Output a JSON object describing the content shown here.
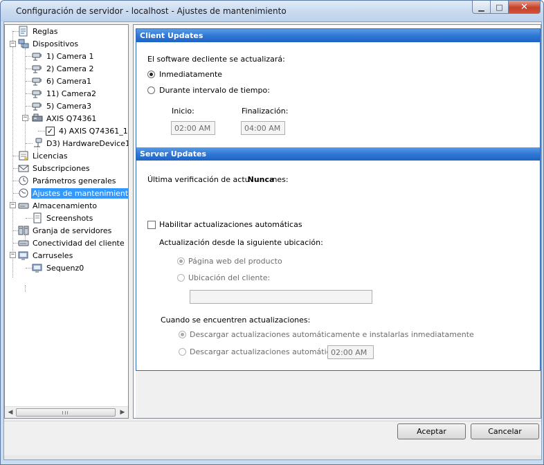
{
  "window": {
    "title": "Configuración de servidor - localhost - Ajustes de mantenimiento",
    "minimize_glyph": "▁",
    "maximize_glyph": "□",
    "close_glyph": "✕"
  },
  "tree": {
    "items": [
      {
        "label": "Reglas",
        "icon": "rules-icon"
      },
      {
        "label": "Dispositivos",
        "icon": "devices-icon"
      },
      {
        "label": "1) Camera 1",
        "icon": "camera-icon"
      },
      {
        "label": "2) Camera 2",
        "icon": "camera-icon"
      },
      {
        "label": "6) Camera1",
        "icon": "camera-icon"
      },
      {
        "label": "11) Camera2",
        "icon": "camera-icon"
      },
      {
        "label": "5) Camera3",
        "icon": "camera-icon"
      },
      {
        "label": "AXIS Q74361",
        "icon": "encoder-icon"
      },
      {
        "label": "4) AXIS Q74361_1",
        "icon": "checkbox-icon"
      },
      {
        "label": "D3) HardwareDevice1",
        "icon": "hardware-device-icon"
      },
      {
        "label": "Licencias",
        "icon": "licenses-icon"
      },
      {
        "label": "Subscripciones",
        "icon": "subscriptions-icon"
      },
      {
        "label": "Parámetros generales",
        "icon": "general-settings-icon"
      },
      {
        "label": "Ajustes de mantenimiento",
        "icon": "maintenance-icon"
      },
      {
        "label": "Almacenamiento",
        "icon": "storage-icon"
      },
      {
        "label": "Screenshots",
        "icon": "screenshots-icon"
      },
      {
        "label": "Granja de servidores",
        "icon": "server-farm-icon"
      },
      {
        "label": "Conectividad del cliente",
        "icon": "client-connectivity-icon"
      },
      {
        "label": "Carruseles",
        "icon": "carousels-icon"
      },
      {
        "label": "Sequenz0",
        "icon": "sequence-icon"
      }
    ],
    "selected_index": 13,
    "checked_item": "4) AXIS Q74361_1",
    "scroll_left_glyph": "◀",
    "scroll_right_glyph": "▶"
  },
  "client_updates": {
    "header": "Client Updates",
    "prompt": "El software decliente se actualizará:",
    "option_immediately": "Inmediatamente",
    "option_interval": "Durante intervalo de tiempo:",
    "selected_option": "Inmediatamente",
    "start_label": "Inicio:",
    "start_value": "02:00 AM",
    "end_label": "Finalización:",
    "end_value": "04:00 AM"
  },
  "server_updates": {
    "header": "Server Updates",
    "last_check_prefix": "Última verificación de actu",
    "last_check_value": "Nunca",
    "last_check_suffix": "nes:",
    "enable_auto_label": "Habilitar actualizaciones automáticas",
    "enable_auto_checked": false,
    "location_label": "Actualización desde la siguiente ubicación:",
    "location_product_web": "Página web del producto",
    "location_client": "Ubicación del cliente:",
    "location_selected": "Página web del producto",
    "client_location_value": "",
    "when_found_label": "Cuando se encuentren actualizaciones:",
    "option_install_now": "Descargar actualizaciones automáticamente e instalarlas inmediatamente",
    "option_download_at": "Descargar actualizaciones automátic",
    "download_time_value": "02:00 AM",
    "when_found_selected": "Descargar actualizaciones automáticamente e instalarlas inmediatamente"
  },
  "buttons": {
    "accept": "Aceptar",
    "cancel": "Cancelar"
  },
  "colors": {
    "section_header": "#2f78d6",
    "selection": "#3399ff",
    "close_button": "#c7412a"
  }
}
